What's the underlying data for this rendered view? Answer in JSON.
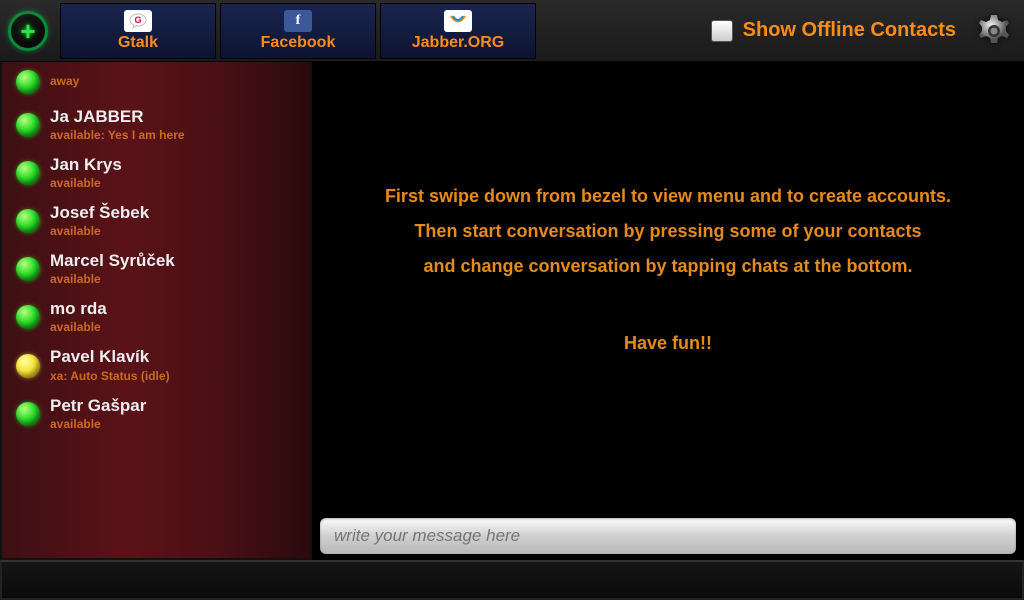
{
  "topbar": {
    "accounts": [
      {
        "label": "Gtalk",
        "icon_kind": "gt"
      },
      {
        "label": "Facebook",
        "icon_kind": "fb"
      },
      {
        "label": "Jabber.ORG",
        "icon_kind": "xm"
      }
    ],
    "show_offline_label": "Show Offline Contacts"
  },
  "contacts": [
    {
      "name": "",
      "status": "away",
      "dot": "green",
      "only_status": true
    },
    {
      "name": "Ja JABBER",
      "status": "available: Yes I am here",
      "dot": "green"
    },
    {
      "name": "Jan Krys",
      "status": "available",
      "dot": "green"
    },
    {
      "name": "Josef Šebek",
      "status": "available",
      "dot": "green"
    },
    {
      "name": "Marcel Syrůček",
      "status": "available",
      "dot": "green"
    },
    {
      "name": "mo rda",
      "status": "available",
      "dot": "green"
    },
    {
      "name": "Pavel Klavík",
      "status": "xa: Auto Status (idle)",
      "dot": "yellow"
    },
    {
      "name": "Petr Gašpar",
      "status": "available",
      "dot": "green"
    }
  ],
  "welcome": {
    "line1": "First swipe down from bezel to view menu and to create accounts.",
    "line2": "Then start conversation by pressing some of your contacts",
    "line3": "and change conversation by tapping chats at the bottom.",
    "line4": "Have fun!!"
  },
  "compose": {
    "placeholder": "write your message here"
  }
}
